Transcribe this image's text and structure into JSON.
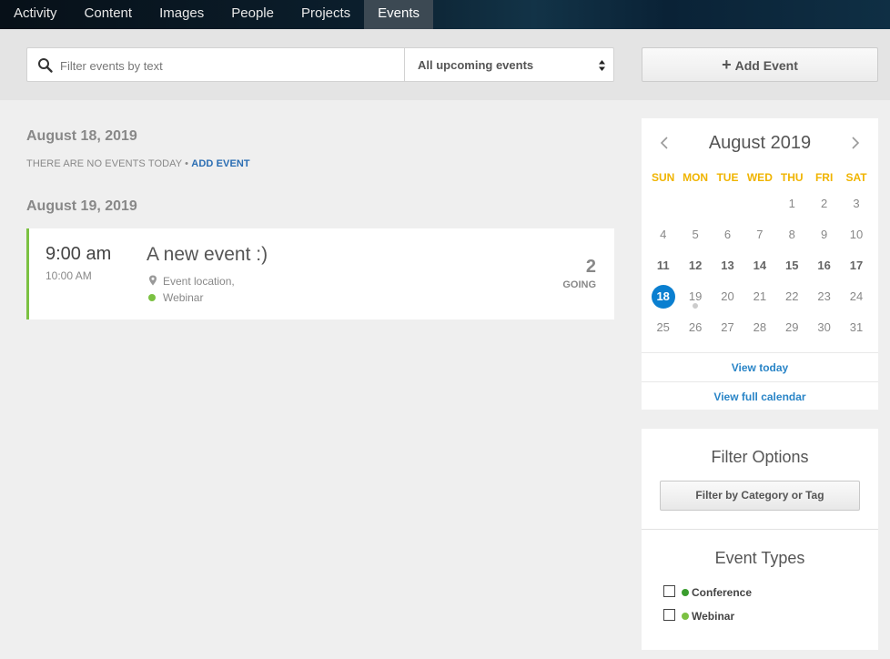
{
  "nav": {
    "tabs": [
      {
        "label": "Activity"
      },
      {
        "label": "Content"
      },
      {
        "label": "Images"
      },
      {
        "label": "People"
      },
      {
        "label": "Projects"
      },
      {
        "label": "Events"
      }
    ],
    "active": "Events"
  },
  "filters": {
    "search_placeholder": "Filter events by text",
    "range_selected": "All upcoming events",
    "add_event_label": "Add Event"
  },
  "days": [
    {
      "date": "August 18, 2019",
      "empty_text": "THERE ARE NO EVENTS TODAY •",
      "add_link": "ADD EVENT"
    },
    {
      "date": "August 19, 2019"
    }
  ],
  "event": {
    "start": "9:00 am",
    "end": "10:00 AM",
    "title": "A new event :)",
    "location": "Event location,",
    "type": "Webinar",
    "going_count": "2",
    "going_label": "GOING",
    "accent_color": "#7bc142"
  },
  "calendar": {
    "title": "August 2019",
    "weekdays": [
      "SUN",
      "MON",
      "TUE",
      "WED",
      "THU",
      "FRI",
      "SAT"
    ],
    "weeks": [
      [
        "",
        "",
        "",
        "",
        "1",
        "2",
        "3"
      ],
      [
        "4",
        "5",
        "6",
        "7",
        "8",
        "9",
        "10"
      ],
      [
        "11",
        "12",
        "13",
        "14",
        "15",
        "16",
        "17"
      ],
      [
        "18",
        "19",
        "20",
        "21",
        "22",
        "23",
        "24"
      ],
      [
        "25",
        "26",
        "27",
        "28",
        "29",
        "30",
        "31"
      ]
    ],
    "today": "18",
    "event_days": [
      "19"
    ],
    "bold_days": [
      "11",
      "12",
      "13",
      "14",
      "15",
      "16",
      "17"
    ],
    "view_today": "View today",
    "view_full": "View full calendar",
    "today_color": "#0a7fd0",
    "weekday_color": "#f0b400"
  },
  "filter_panel": {
    "title": "Filter Options",
    "button_label": "Filter by Category or Tag",
    "types_title": "Event Types",
    "types": [
      {
        "label": "Conference",
        "color": "#3a9d2e"
      },
      {
        "label": "Webinar",
        "color": "#7bc142"
      }
    ]
  }
}
